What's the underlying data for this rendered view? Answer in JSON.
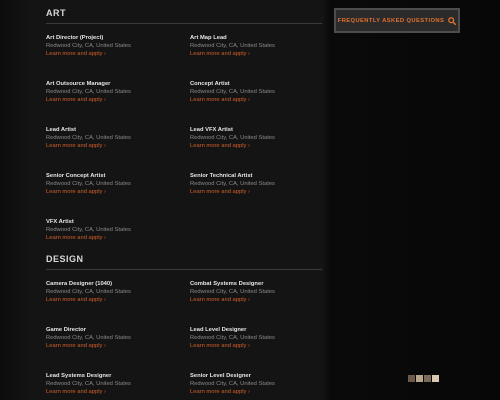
{
  "faq": {
    "label": "FREQUENTLY ASKED QUESTIONS",
    "icon": "search-icon",
    "accent": "#e0702f"
  },
  "colors": {
    "background": "#141414",
    "link": "#d4602a",
    "title": "#e6e6e6",
    "location": "#8a8a8a"
  },
  "sections": [
    {
      "title": "ART",
      "jobs": [
        {
          "title": "Art Director (Project)",
          "location": "Redwood City, CA, United States",
          "link": "Learn more and apply ›"
        },
        {
          "title": "Art Map Lead",
          "location": "Redwood City, CA, United States",
          "link": "Learn more and apply ›"
        },
        {
          "title": "Art Outsource Manager",
          "location": "Redwood City, CA, United States",
          "link": "Learn more and apply ›"
        },
        {
          "title": "Concept Artist",
          "location": "Redwood City, CA, United States",
          "link": "Learn more and apply ›"
        },
        {
          "title": "Lead Artist",
          "location": "Redwood City, CA, United States",
          "link": "Learn more and apply ›"
        },
        {
          "title": "Lead VFX Artist",
          "location": "Redwood City, CA, United States",
          "link": "Learn more and apply ›"
        },
        {
          "title": "Senior Concept Artist",
          "location": "Redwood City, CA, United States",
          "link": "Learn more and apply ›"
        },
        {
          "title": "Senior Technical Artist",
          "location": "Redwood City, CA, United States",
          "link": "Learn more and apply ›"
        },
        {
          "title": "VFX Artist",
          "location": "Redwood City, CA, United States",
          "link": "Learn more and apply ›"
        }
      ]
    },
    {
      "title": "DESIGN",
      "jobs": [
        {
          "title": "Camera Designer (1040)",
          "location": "Redwood City, CA, United States",
          "link": "Learn more and apply ›"
        },
        {
          "title": "Combat Systems Designer",
          "location": "Redwood City, CA, United States",
          "link": "Learn more and apply ›"
        },
        {
          "title": "Game Director",
          "location": "Redwood City, CA, United States",
          "link": "Learn more and apply ›"
        },
        {
          "title": "Lead Level Designer",
          "location": "Redwood City, CA, United States",
          "link": "Learn more and apply ›"
        },
        {
          "title": "Lead Systems Designer",
          "location": "Redwood City, CA, United States",
          "link": "Learn more and apply ›"
        },
        {
          "title": "Senior Level Designer",
          "location": "Redwood City, CA, United States",
          "link": "Learn more and apply ›"
        }
      ]
    }
  ]
}
